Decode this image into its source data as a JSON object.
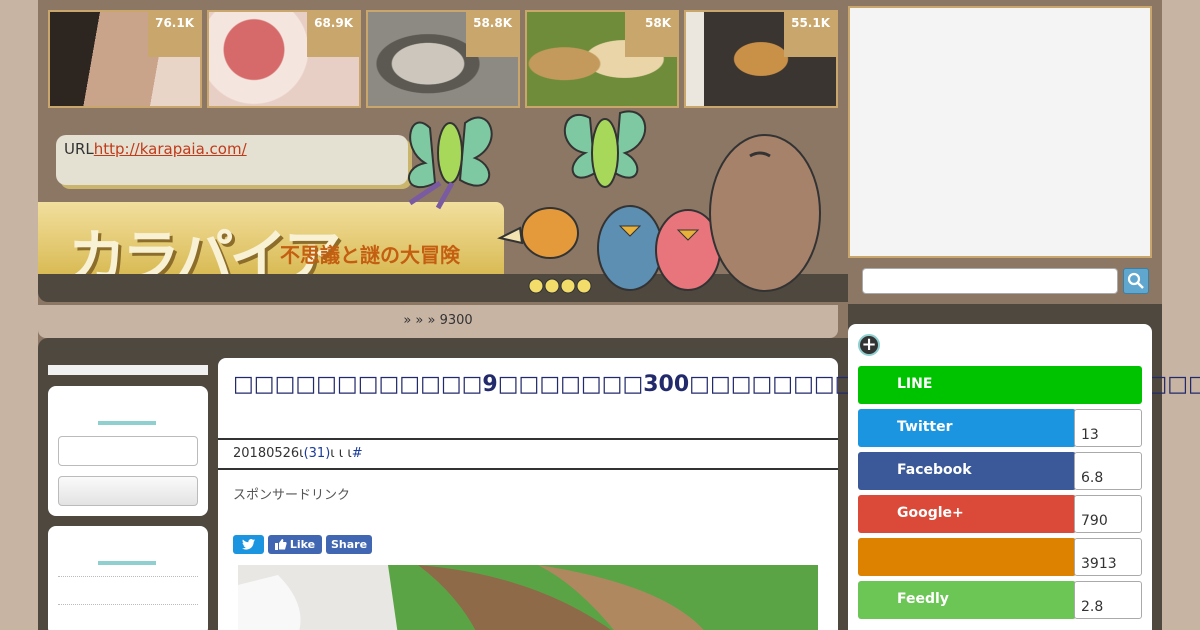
{
  "thumbnails": [
    {
      "count": "76.1K",
      "colors": [
        "#2d2620",
        "#c9a38a",
        "#e8d5c8"
      ]
    },
    {
      "count": "68.9K",
      "colors": [
        "#e8cfc6",
        "#d66a6a",
        "#f4e6df"
      ]
    },
    {
      "count": "58.8K",
      "colors": [
        "#8d8a84",
        "#ccc6bd",
        "#5c5852"
      ]
    },
    {
      "count": "58K",
      "colors": [
        "#6f8c3a",
        "#e9d5a8",
        "#c49a5c"
      ]
    },
    {
      "count": "55.1K",
      "colors": [
        "#3a3530",
        "#c99048",
        "#ebe6de"
      ]
    }
  ],
  "header": {
    "url_label": "URL",
    "url_link": "http://karapaia.com/",
    "logo": "カラパイア",
    "tagline": "不思議と謎の大冒険"
  },
  "breadcrumb": "»   »  » 9300",
  "article": {
    "title": "□□□□□□□□□□□□9□□□□□□□300□□□□□□□□□□□□□□□□□□□□□□□□□",
    "date": "20180526",
    "mark1": "ι",
    "comments": "(31)",
    "mark2": "ι ι ι",
    "hash": "#",
    "sponsor": "スポンサードリンク",
    "like_label": "Like",
    "share_label": "Share"
  },
  "share": [
    {
      "name": "LINE",
      "count": "",
      "color": "#00c300"
    },
    {
      "name": "Twitter",
      "count": "13",
      "color": "#1b95e0"
    },
    {
      "name": "Facebook",
      "count": "6.8",
      "color": "#3b5998"
    },
    {
      "name": "Google+",
      "count": "790",
      "color": "#db4a39"
    },
    {
      "name": "",
      "count": "3913",
      "color": "#dd8200"
    },
    {
      "name": "Feedly",
      "count": "2.8",
      "color": "#6cc655"
    }
  ]
}
